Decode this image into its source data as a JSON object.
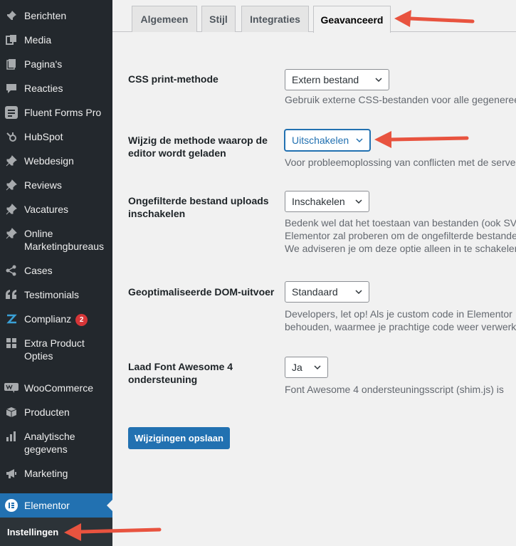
{
  "sidebar": {
    "items": [
      {
        "label": "Berichten",
        "icon": "pin-icon"
      },
      {
        "label": "Media",
        "icon": "media-icon"
      },
      {
        "label": "Pagina's",
        "icon": "pages-icon"
      },
      {
        "label": "Reacties",
        "icon": "comments-icon"
      },
      {
        "label": "Fluent Forms Pro",
        "icon": "forms-icon"
      },
      {
        "label": "HubSpot",
        "icon": "hubspot-icon"
      },
      {
        "label": "Webdesign",
        "icon": "pin-icon"
      },
      {
        "label": "Reviews",
        "icon": "pin-icon"
      },
      {
        "label": "Vacatures",
        "icon": "pin-icon"
      },
      {
        "label": "Online Marketingbureaus",
        "icon": "pin-icon"
      },
      {
        "label": "Cases",
        "icon": "share-icon"
      },
      {
        "label": "Testimonials",
        "icon": "quote-icon"
      },
      {
        "label": "Complianz",
        "icon": "complianz-icon",
        "badge": "2"
      },
      {
        "label": "Extra Product Opties",
        "icon": "grid-icon"
      },
      {
        "label": "WooCommerce",
        "icon": "woocommerce-icon"
      },
      {
        "label": "Producten",
        "icon": "box-icon"
      },
      {
        "label": "Analytische gegevens",
        "icon": "chart-icon"
      },
      {
        "label": "Marketing",
        "icon": "megaphone-icon"
      }
    ],
    "active": {
      "label": "Elementor",
      "icon": "elementor-icon"
    },
    "submenu": {
      "label": "Instellingen"
    }
  },
  "tabs": [
    "Algemeen",
    "Stijl",
    "Integraties",
    "Geavanceerd"
  ],
  "active_tab": "Geavanceerd",
  "settings": [
    {
      "label": "CSS print-methode",
      "value": "Extern bestand",
      "desc": [
        "Gebruik externe CSS-bestanden voor alle gegenereerde"
      ]
    },
    {
      "label": "Wijzig de methode waarop de editor wordt geladen",
      "value": "Uitschakelen",
      "desc": [
        "Voor probleemoplossing van conflicten met de server"
      ]
    },
    {
      "label": "Ongefilterde bestand uploads inschakelen",
      "value": "Inschakelen",
      "desc": [
        "Bedenk wel dat het toestaan van bestanden (ook SVG",
        "Elementor zal proberen om de ongefilterde bestanden",
        "We adviseren je om deze optie alleen in te schakelen"
      ]
    },
    {
      "label": "Geoptimaliseerde DOM-uitvoer",
      "value": "Standaard",
      "desc": [
        "Developers, let op! Als je custom code in Elementor",
        "behouden, waarmee je prachtige code weer verwerkt"
      ]
    },
    {
      "label": "Laad Font Awesome 4 ondersteuning",
      "value": "Ja",
      "desc": [
        "Font Awesome 4 ondersteuningsscript (shim.js) is"
      ]
    }
  ],
  "save_button": "Wijzigingen opslaan",
  "colors": {
    "sidebar_bg": "#23282d",
    "accent": "#2271b1",
    "annotation_arrow": "#e8533f",
    "badge": "#d63638"
  }
}
